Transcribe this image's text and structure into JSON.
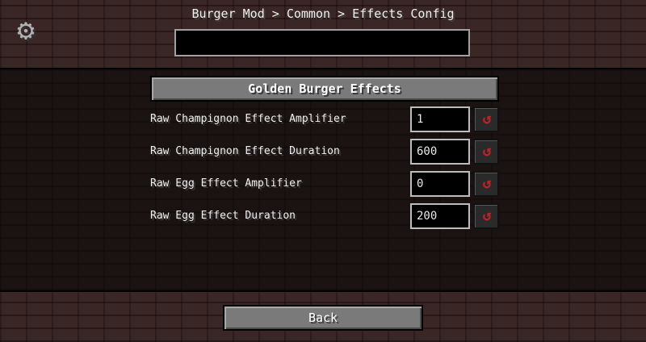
{
  "header": {
    "breadcrumb": "Burger Mod > Common > Effects Config",
    "search": {
      "value": "",
      "placeholder": ""
    },
    "gear_icon": "gear-icon"
  },
  "section": {
    "title": "Golden Burger Effects"
  },
  "rows": [
    {
      "label": "Raw Champignon Effect Amplifier",
      "value": "1",
      "reset_icon": "reset-icon"
    },
    {
      "label": "Raw Champignon Effect Duration",
      "value": "600",
      "reset_icon": "reset-icon"
    },
    {
      "label": "Raw Egg Effect Amplifier",
      "value": "0",
      "reset_icon": "reset-icon"
    },
    {
      "label": "Raw Egg Effect Duration",
      "value": "200",
      "reset_icon": "reset-icon"
    }
  ],
  "footer": {
    "back_label": "Back"
  },
  "colors": {
    "background": "#3a2624",
    "list_background": "#1a1312",
    "button": "#7a7a7a",
    "reset_icon": "#c4202a"
  }
}
